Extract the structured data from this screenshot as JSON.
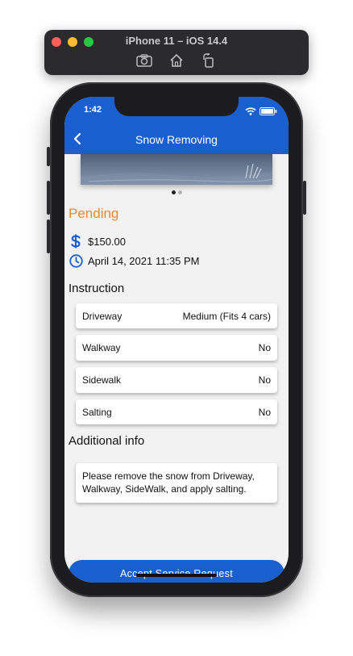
{
  "simulator": {
    "title": "iPhone 11 – iOS 14.4",
    "tools": [
      "camera-icon",
      "home-icon",
      "rotate-icon"
    ]
  },
  "status_bar": {
    "time": "1:42"
  },
  "nav": {
    "title": "Snow Removing",
    "back_icon": "chevron-left-icon"
  },
  "gallery": {
    "page_count": 2,
    "current_page": 1
  },
  "request": {
    "status": "Pending",
    "price": "$150.00",
    "datetime": "April 14, 2021 11:35 PM"
  },
  "instruction": {
    "heading": "Instruction",
    "items": [
      {
        "label": "Driveway",
        "value": "Medium (Fits 4 cars)"
      },
      {
        "label": "Walkway",
        "value": "No"
      },
      {
        "label": "Sidewalk",
        "value": "No"
      },
      {
        "label": "Salting",
        "value": "No"
      }
    ]
  },
  "additional": {
    "heading": "Additional info",
    "text": "Please remove the snow from Driveway, Walkway, SideWalk, and apply salting."
  },
  "actions": {
    "accept_label": "Accept Service Request"
  },
  "colors": {
    "primary": "#1a5fd0",
    "pending": "#e88a2a",
    "background": "#f2f2f2"
  }
}
